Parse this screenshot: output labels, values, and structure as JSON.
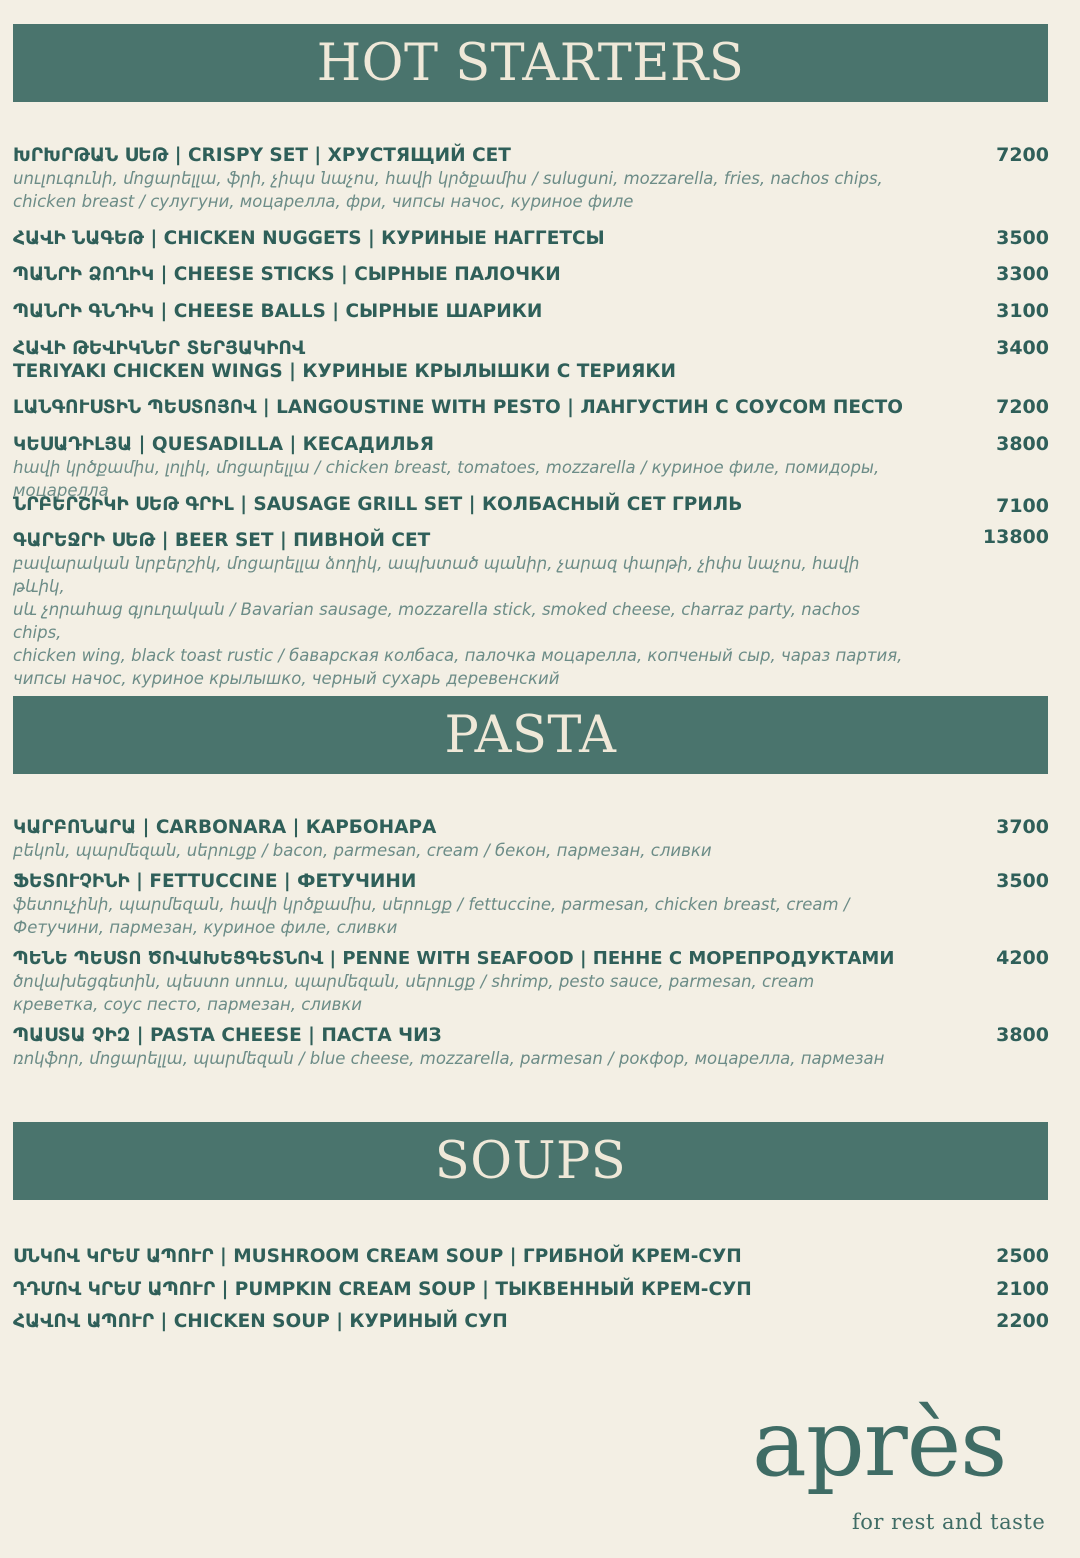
{
  "sections": {
    "hot_starters": {
      "title": "HOT STARTERS",
      "items": [
        {
          "name": "ԽՐԽՐԹԱՆ ՍԵԹ | CRISPY SET | ХРУСТЯЩИЙ СЕТ",
          "price": "7200",
          "desc": "սուլուգունի, մոցարելլա, ֆրի, չիպս նաչոս, հավի կրծքամիս / suluguni, mozzarella, fries, nachos chips,\nchicken breast / сулугуни, моцарелла, фри, чипсы начос, куриное филе"
        },
        {
          "name": "ՀԱՎԻ ՆԱԳԵԹ | CHICKEN NUGGETS | КУРИНЫЕ НАГГЕТСЫ",
          "price": "3500"
        },
        {
          "name": "ՊԱՆՐԻ ՁՈՂԻԿ | CHEESE STICKS | СЫРНЫЕ ПАЛОЧКИ",
          "price": "3300"
        },
        {
          "name": "ՊԱՆՐԻ ԳՆԴԻԿ | CHEESE BALLS | СЫРНЫЕ ШАРИКИ",
          "price": "3100"
        },
        {
          "name": "ՀԱՎԻ ԹԵՎԻԿՆԵՐ ՏԵՐՅԱԿԻՈՎ\nTERIYAKI CHICKEN WINGS | КУРИНЫЕ КРЫЛЫШКИ С ТЕРИЯКИ",
          "price": "3400"
        },
        {
          "name": "ԼԱՆԳՈՒՍՏԻՆ ՊԵՍՏՈՅՈՎ | LANGOUSTINE WITH PESTO | ЛАНГУСТИН С СОУСОМ ПЕСТО",
          "price": "7200"
        },
        {
          "name": "ԿԵՍԱԴԻԼՅԱ | QUESADILLA | КЕСАДИЛЬЯ",
          "price": "3800",
          "desc": "հավի կրծքամիս, լոլիկ, մոցարելլա / chicken breast, tomatoes, mozzarella / куриное филе, помидоры, моцарелла"
        },
        {
          "name": "ՆՐԲԵՐՇԻԿԻ ՍԵԹ ԳՐԻԼ | SAUSAGE GRILL SET | КОЛБАСНЫЙ СЕТ ГРИЛЬ",
          "price": "7100"
        },
        {
          "name": "ԳԱՐԵՋՐԻ ՍԵԹ | BEER SET | ПИВНОЙ СЕТ",
          "price": "13800",
          "desc": "բավարական նրբերշիկ, մոցարելլա ձողիկ, ապխտած պանիր, չարազ փարթի, չիփս նաչոս, հավի թևիկ,\nսև չորահաց գյուղական / Bavarian sausage, mozzarella stick, smoked cheese, charraz party, nachos chips,\nchicken wing, black toast rustic / баварская колбаса, палочка моцарелла, копченый сыр, чараз партия,\nчипсы начос, куриное крылышко, черный сухарь деревенский"
        }
      ]
    },
    "pasta": {
      "title": "PASTA",
      "items": [
        {
          "name": "ԿԱՐԲՈՆԱՐԱ | CARBONARA | КАРБОНАРА",
          "price": "3700",
          "desc": "բեկոն, պարմեզան, սերուցք / bacon, parmesan, cream / бекон, пармезан, сливки"
        },
        {
          "name": "ՖԵՏՈՒՉԻՆԻ | FETTUCCINE | ФЕТУЧИНИ",
          "price": "3500",
          "desc": "ֆետուչինի, պարմեզան, հավի կրծքամիս, սերուցք / fettuccine, parmesan, chicken breast, cream /\nФетучини, пармезан, куриное филе, сливки"
        },
        {
          "name": "ՊԵՆԵ ՊԵՍՏՈ ԾՈՎԱԽԵՑԳԵՏՆՈՎ | PENNE WITH SEAFOOD | ПЕННЕ С МОРЕПРОДУКТАМИ",
          "price": "4200",
          "desc": "ծովախեցգետին, պեստո սոուս, պարմեզան, սերուցք / shrimp, pesto sauce, parmesan, cream\nкреветка, соус песто, пармезан, сливки"
        },
        {
          "name": "ՊԱՍՏԱ ՉԻԶ | PASTA CHEESE | ПАСТА ЧИЗ",
          "price": "3800",
          "desc": "ռոկֆոր, մոցարելլա, պարմեզան / blue cheese, mozzarella, parmesan / рокфор, моцарелла, пармезан"
        }
      ]
    },
    "soups": {
      "title": "SOUPS",
      "items": [
        {
          "name": "ՍՆԿՈՎ ԿՐԵՄ ԱՊՈՒՐ | MUSHROOM CREAM SOUP | ГРИБНОЙ КРЕМ-СУП",
          "price": "2500"
        },
        {
          "name": "ԴԴՄՈՎ ԿՐԵՄ ԱՊՈՒՐ | PUMPKIN CREAM SOUP | ТЫКВЕННЫЙ КРЕМ-СУП",
          "price": "2100"
        },
        {
          "name": "ՀԱՎՈՎ ԱՊՈՒՐ | CHICKEN SOUP | КУРИНЫЙ СУП",
          "price": "2200"
        }
      ]
    }
  },
  "brand": {
    "name": "après",
    "tagline": "for rest and taste"
  },
  "colors": {
    "background": "#f3efe4",
    "banner": "#4a746d",
    "text": "#2f5f59",
    "description": "#6c8c87"
  }
}
